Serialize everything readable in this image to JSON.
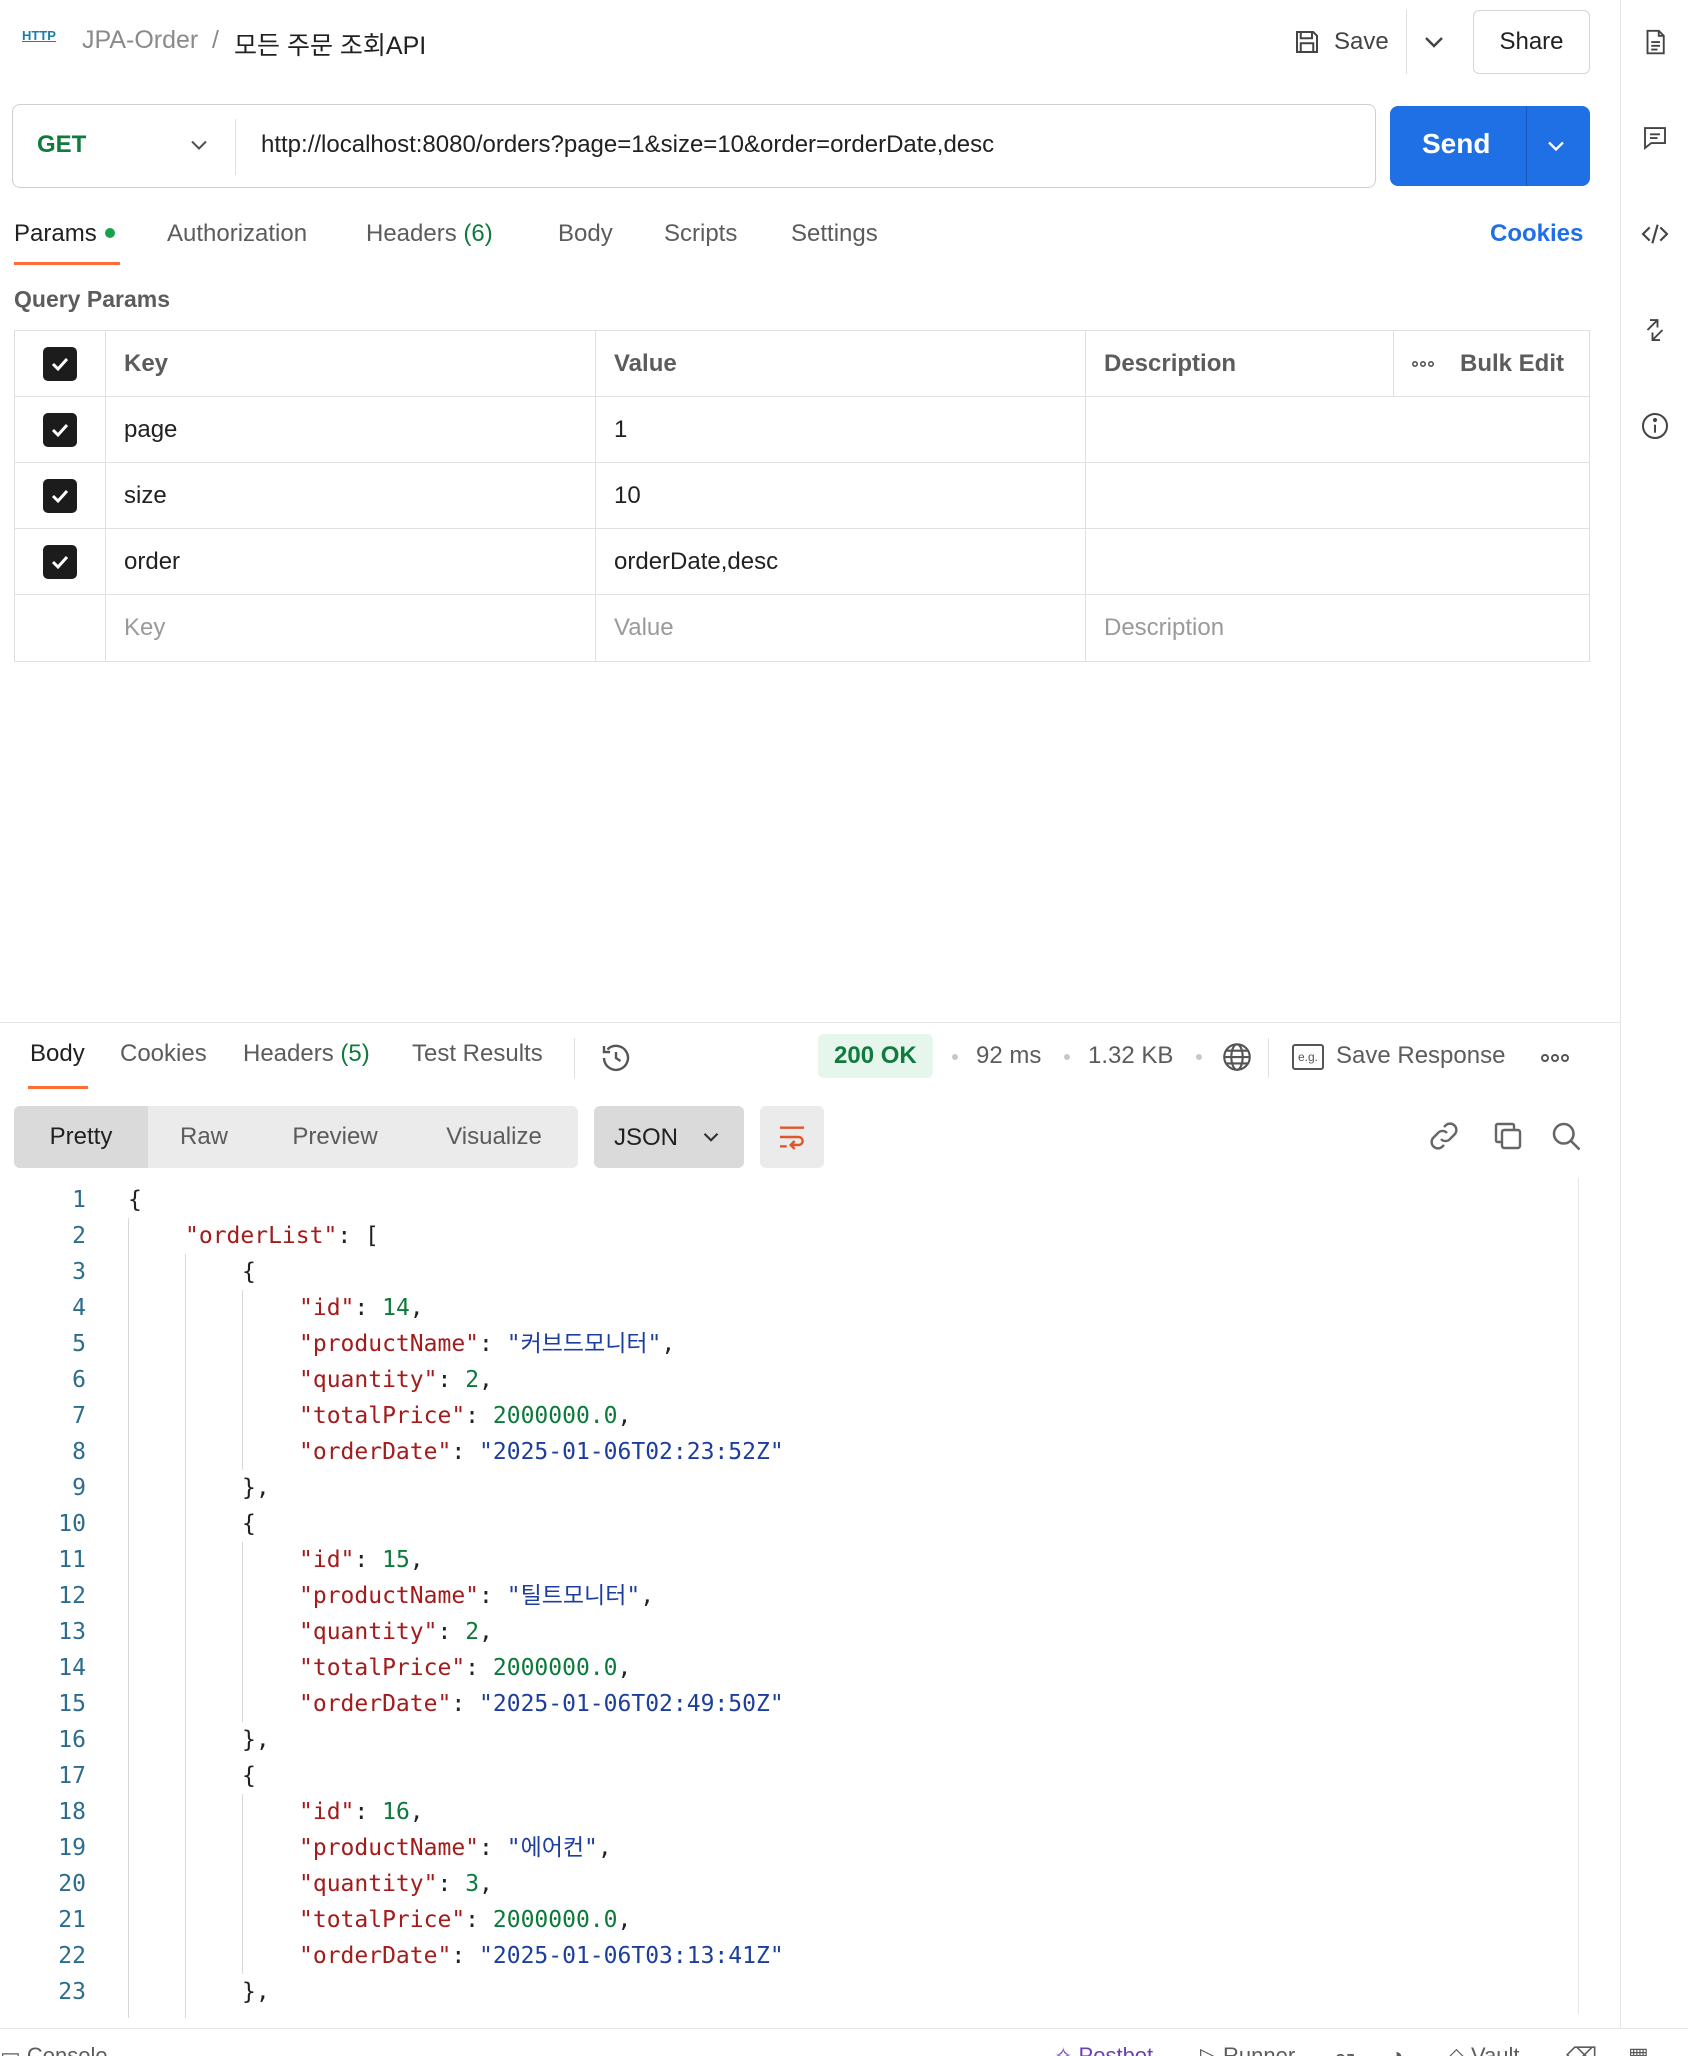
{
  "header": {
    "http_badge": "HTTP",
    "collection": "JPA-Order",
    "separator": "/",
    "request_name": "모든 주문 조회API",
    "save_label": "Save",
    "share_label": "Share"
  },
  "request": {
    "method": "GET",
    "url": "http://localhost:8080/orders?page=1&size=10&order=orderDate,desc",
    "send_label": "Send"
  },
  "request_tabs": {
    "params": "Params",
    "authorization": "Authorization",
    "headers": "Headers",
    "headers_count": "(6)",
    "body": "Body",
    "scripts": "Scripts",
    "settings": "Settings",
    "cookies": "Cookies"
  },
  "query_params": {
    "section_label": "Query Params",
    "headers": {
      "key": "Key",
      "value": "Value",
      "description": "Description",
      "bulk_edit": "Bulk Edit"
    },
    "rows": [
      {
        "key": "page",
        "value": "1",
        "description": "",
        "checked": true
      },
      {
        "key": "size",
        "value": "10",
        "description": "",
        "checked": true
      },
      {
        "key": "order",
        "value": "orderDate,desc",
        "description": "",
        "checked": true
      }
    ],
    "placeholders": {
      "key": "Key",
      "value": "Value",
      "description": "Description"
    }
  },
  "response": {
    "tabs": {
      "body": "Body",
      "cookies": "Cookies",
      "headers": "Headers",
      "headers_count": "(5)",
      "test_results": "Test Results"
    },
    "status": "200 OK",
    "time": "92 ms",
    "size": "1.32 KB",
    "save_response": "Save Response",
    "views": [
      "Pretty",
      "Raw",
      "Preview",
      "Visualize"
    ],
    "active_view": "Pretty",
    "format": "JSON"
  },
  "code_lines": [
    "{",
    "\"orderList\": [",
    "{",
    "\"id\": 14,",
    "\"productName\": \"커브드모니터\",",
    "\"quantity\": 2,",
    "\"totalPrice\": 2000000.0,",
    "\"orderDate\": \"2025-01-06T02:23:52Z\"",
    "},",
    "{",
    "\"id\": 15,",
    "\"productName\": \"틸트모니터\",",
    "\"quantity\": 2,",
    "\"totalPrice\": 2000000.0,",
    "\"orderDate\": \"2025-01-06T02:49:50Z\"",
    "},",
    "{",
    "\"id\": 16,",
    "\"productName\": \"에어컨\",",
    "\"quantity\": 3,",
    "\"totalPrice\": 2000000.0,",
    "\"orderDate\": \"2025-01-06T03:13:41Z\"",
    "},"
  ],
  "status_bar": {
    "console": "Console",
    "postbot": "Postbot",
    "runner": "Runner",
    "vault": "Vault"
  },
  "colors": {
    "send_button": "#1f6fe5",
    "method_get": "#0f7b3c",
    "tab_accent": "#ff6c37",
    "status_ok_bg": "#e7f6ec",
    "json_key": "#a31b1b",
    "json_string": "#1c3e9c",
    "json_number": "#0b7a3b"
  }
}
